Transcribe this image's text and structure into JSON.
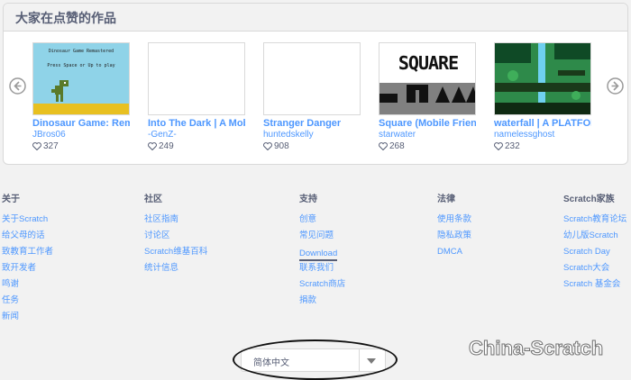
{
  "featured": {
    "title": "大家在点赞的作品",
    "projects": [
      {
        "title": "Dinosaur Game: Remastered",
        "author": "JBros06",
        "likes": "327",
        "thumb_text": "Dinosaur Game Remastered",
        "thumb_hint": "Press Space or Up to play"
      },
      {
        "title": "Into The Dark | A Mobile Game",
        "author": "-GenZ-",
        "likes": "249"
      },
      {
        "title": "Stranger Danger",
        "author": "huntedskelly",
        "likes": "908"
      },
      {
        "title": "Square (Mobile Friendly)",
        "author": "starwater",
        "likes": "268",
        "thumb_text": "SQUARE"
      },
      {
        "title": "waterfall | A PLATFORMER",
        "author": "namelessghost",
        "likes": "232"
      }
    ]
  },
  "footer": {
    "columns": [
      {
        "heading": "关于",
        "links": [
          "关于Scratch",
          "给父母的话",
          "致教育工作者",
          "致开发者",
          "鸣谢",
          "任务",
          "新闻"
        ]
      },
      {
        "heading": "社区",
        "links": [
          "社区指南",
          "讨论区",
          "Scratch维基百科",
          "统计信息"
        ]
      },
      {
        "heading": "支持",
        "links": [
          "创意",
          "常见问题",
          "Download",
          "联系我们",
          "Scratch商店",
          "捐款"
        ]
      },
      {
        "heading": "法律",
        "links": [
          "使用条款",
          "隐私政策",
          "DMCA"
        ]
      },
      {
        "heading": "Scratch家族",
        "links": [
          "Scratch教育论坛",
          "幼儿版Scratch",
          "Scratch Day",
          "Scratch大会",
          "Scratch 基金会"
        ]
      }
    ],
    "language": "简体中文"
  },
  "watermark": "China-Scratch",
  "colors": {
    "link": "#4d97ff",
    "text": "#575e75",
    "background": "#f2f2f2"
  }
}
